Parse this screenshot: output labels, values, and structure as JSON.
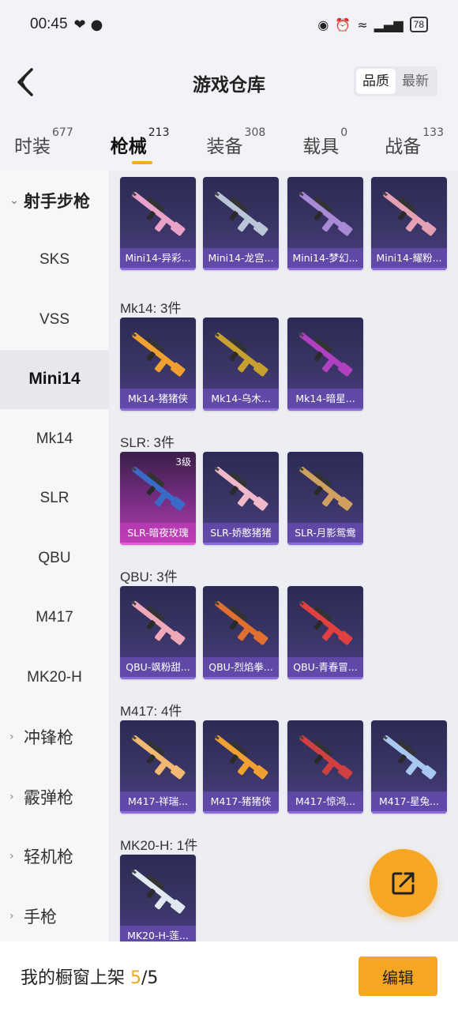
{
  "status": {
    "time": "00:45",
    "battery": "78"
  },
  "header": {
    "title": "游戏仓库",
    "sort_options": [
      "品质",
      "最新"
    ]
  },
  "tabs": [
    {
      "label": "时装",
      "count": "677"
    },
    {
      "label": "枪械",
      "count": "213"
    },
    {
      "label": "装备",
      "count": "308"
    },
    {
      "label": "载具",
      "count": "0"
    },
    {
      "label": "战备",
      "count": "133"
    }
  ],
  "sidebar": [
    {
      "label": "射手步枪",
      "type": "group-open"
    },
    {
      "label": "SKS",
      "type": "item"
    },
    {
      "label": "VSS",
      "type": "item"
    },
    {
      "label": "Mini14",
      "type": "active"
    },
    {
      "label": "Mk14",
      "type": "item"
    },
    {
      "label": "SLR",
      "type": "item"
    },
    {
      "label": "QBU",
      "type": "item"
    },
    {
      "label": "M417",
      "type": "item"
    },
    {
      "label": "MK20-H",
      "type": "item"
    },
    {
      "label": "冲锋枪",
      "type": "group"
    },
    {
      "label": "霰弹枪",
      "type": "group"
    },
    {
      "label": "轻机枪",
      "type": "group"
    },
    {
      "label": "手枪",
      "type": "group"
    }
  ],
  "sections": [
    {
      "title": "",
      "items": [
        {
          "name": "Mini14-异彩...",
          "color": "#e9a3c9"
        },
        {
          "name": "Mini14-龙宫...",
          "color": "#b8c6d8"
        },
        {
          "name": "Mini14-梦幻...",
          "color": "#a98ad6"
        },
        {
          "name": "Mini14-耀粉...",
          "color": "#e6a0b4"
        }
      ]
    },
    {
      "title": "Mk14: 3件",
      "items": [
        {
          "name": "Mk14-猪猪侠",
          "color": "#f0a030"
        },
        {
          "name": "Mk14-乌木...",
          "color": "#c8a030"
        },
        {
          "name": "Mk14-暗星...",
          "color": "#b040c0"
        }
      ]
    },
    {
      "title": "SLR: 3件",
      "items": [
        {
          "name": "SLR-暗夜玫瑰",
          "color": "#3a6ac8",
          "level": "3级",
          "purple": true
        },
        {
          "name": "SLR-娇憨猪猪",
          "color": "#f0b8c8"
        },
        {
          "name": "SLR-月影鸳鸯",
          "color": "#d0a060"
        }
      ]
    },
    {
      "title": "QBU: 3件",
      "items": [
        {
          "name": "QBU-飒粉甜...",
          "color": "#f0a8b8"
        },
        {
          "name": "QBU-烈焰拳...",
          "color": "#e07030"
        },
        {
          "name": "QBU-青春冒...",
          "color": "#e04040"
        }
      ]
    },
    {
      "title": "M417: 4件",
      "items": [
        {
          "name": "M417-祥瑞...",
          "color": "#f0b870"
        },
        {
          "name": "M417-猪猪侠",
          "color": "#f0a030"
        },
        {
          "name": "M417-惊鸿...",
          "color": "#d04040"
        },
        {
          "name": "M417-星兔...",
          "color": "#a8c8f0"
        }
      ]
    },
    {
      "title": "MK20-H: 1件",
      "items": [
        {
          "name": "MK20-H-莲...",
          "color": "#e0e8f0"
        }
      ]
    }
  ],
  "bottom": {
    "prefix": "我的橱窗上架 ",
    "current": "5",
    "total": "/5",
    "edit_label": "编辑"
  }
}
